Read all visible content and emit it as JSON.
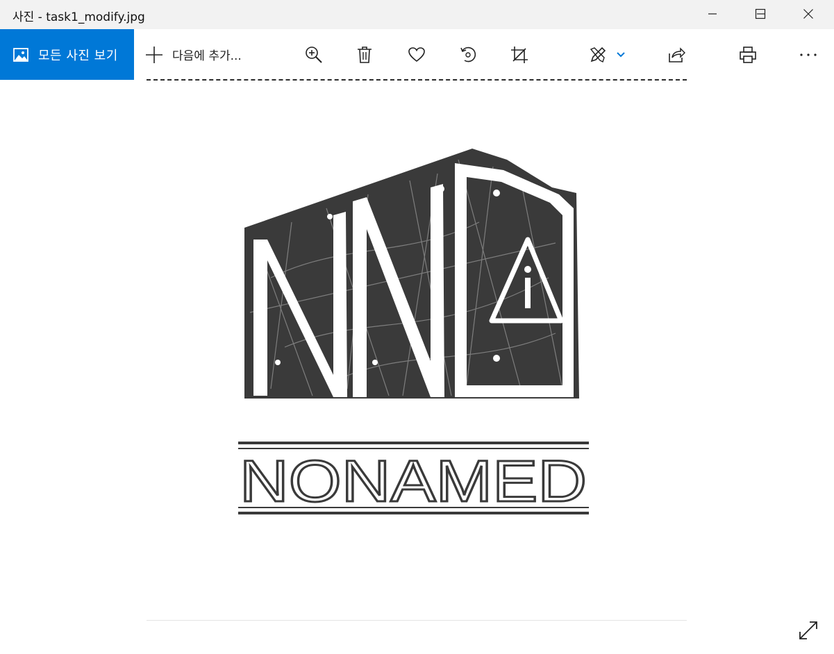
{
  "window": {
    "title": "사진 - task1_modify.jpg",
    "minimize_icon": "minimize-icon",
    "maximize_icon": "maximize-icon",
    "close_icon": "close-icon"
  },
  "toolbar": {
    "all_photos_label": "모든 사진 보기",
    "add_to_label": "다음에 추가...",
    "icons": [
      "zoom-in-icon",
      "delete-icon",
      "favorite-icon",
      "rotate-icon",
      "crop-icon",
      "edit-icon",
      "chevron-down-icon",
      "share-icon",
      "print-icon",
      "more-icon"
    ],
    "accent_color": "#0078d7"
  },
  "photo": {
    "logo_text": "NONAMED",
    "logo_color": "#3a3a3a"
  },
  "footer": {
    "expand_icon": "fullscreen-icon"
  }
}
